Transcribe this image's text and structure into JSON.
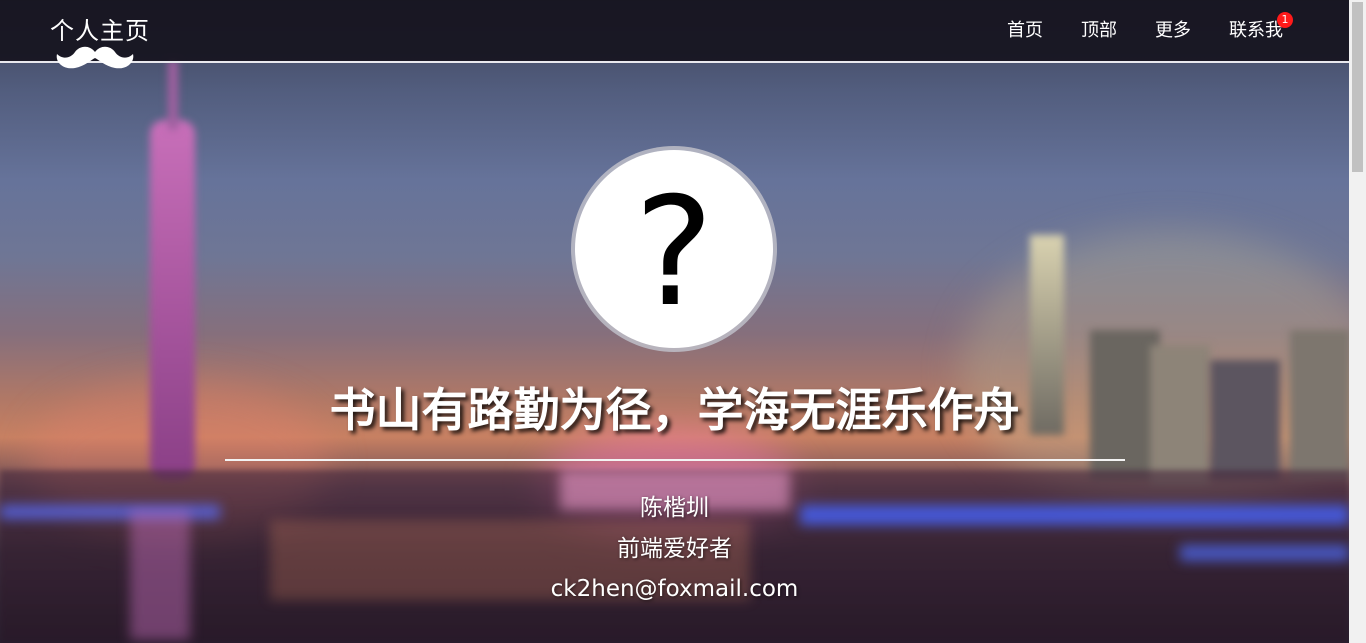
{
  "brand": {
    "title": "个人主页",
    "logo_icon": "mustache-icon"
  },
  "nav": {
    "items": [
      {
        "label": "首页"
      },
      {
        "label": "顶部"
      },
      {
        "label": "更多"
      },
      {
        "label": "联系我",
        "badge": "1"
      }
    ]
  },
  "hero": {
    "avatar_icon": "question-mark-icon",
    "avatar_glyph": "?",
    "motto": "书山有路勤为径，学海无涯乐作舟",
    "name": "陈楷圳",
    "role": "前端爱好者",
    "email": "ck2hen@foxmail.com"
  },
  "colors": {
    "navbar_bg": "#16141e",
    "badge": "#ff1a1a",
    "text": "#ffffff"
  }
}
